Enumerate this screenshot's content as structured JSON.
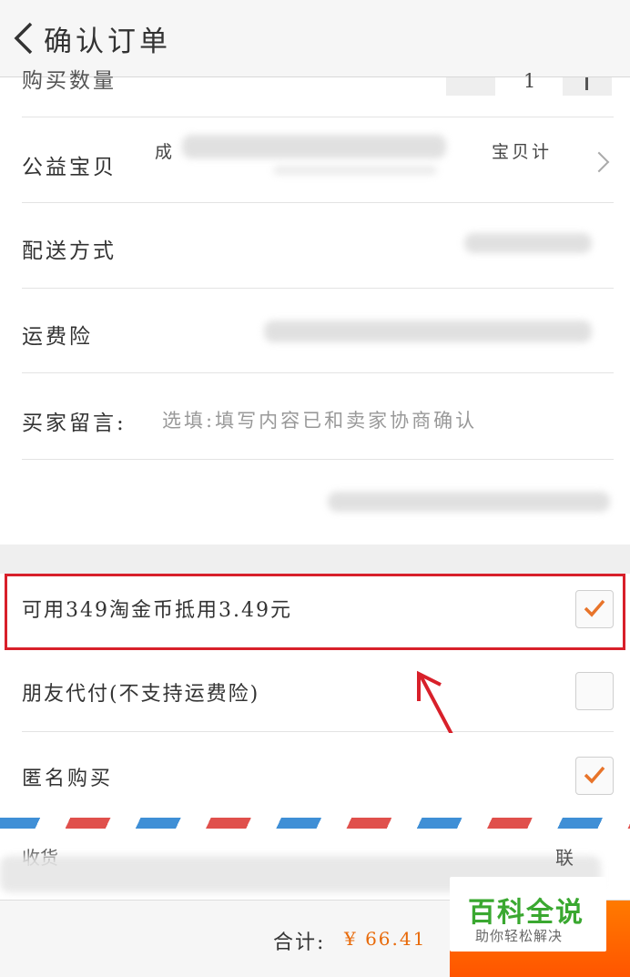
{
  "header": {
    "title": "确认订单",
    "back_icon": "chevron-left-icon"
  },
  "rows": {
    "quantity": {
      "label": "购买数量",
      "value": "1"
    },
    "charity": {
      "label": "公益宝贝",
      "value_start": "成",
      "value_end": "宝贝计"
    },
    "shipping": {
      "label": "配送方式"
    },
    "insurance": {
      "label": "运费险"
    },
    "message": {
      "label": "买家留言:",
      "placeholder": "选填:填写内容已和卖家协商确认"
    }
  },
  "options": {
    "coins": {
      "label": "可用349淘金币抵用3.49元",
      "checked": true
    },
    "friend_pay": {
      "label": "朋友代付(不支持运费险)",
      "checked": false
    },
    "anonymous": {
      "label": "匿名购买",
      "checked": true
    }
  },
  "address": {
    "label_start": "收货",
    "label_end": "联"
  },
  "footer": {
    "total_label": "合计:",
    "total_value": "¥ 66.41"
  },
  "watermark": {
    "title": "百科全说",
    "subtitle": "助你轻松解决"
  },
  "colors": {
    "accent": "#e86a0a",
    "highlight": "#d8202a",
    "check": "#e8742a",
    "watermark": "#3aa830"
  }
}
